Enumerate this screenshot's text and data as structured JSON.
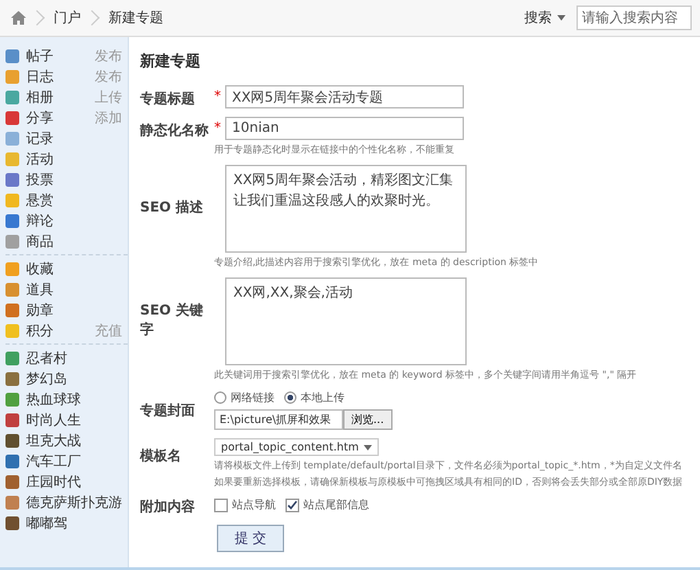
{
  "breadcrumb": {
    "items": [
      "门户",
      "新建专题"
    ],
    "search": {
      "label": "搜索",
      "placeholder": "请输入搜索内容"
    }
  },
  "sidebar": {
    "groups": [
      [
        {
          "label": "帖子",
          "action": "发布",
          "color": "#5a8fc8"
        },
        {
          "label": "日志",
          "action": "发布",
          "color": "#e8a030"
        },
        {
          "label": "相册",
          "action": "上传",
          "color": "#4aa8a0"
        },
        {
          "label": "分享",
          "action": "添加",
          "color": "#d83838"
        },
        {
          "label": "记录",
          "color": "#8ab0d8"
        },
        {
          "label": "活动",
          "color": "#e8b830"
        },
        {
          "label": "投票",
          "color": "#6a78c8"
        },
        {
          "label": "悬赏",
          "color": "#f0b820"
        },
        {
          "label": "辩论",
          "color": "#3878d0"
        },
        {
          "label": "商品",
          "color": "#a0a0a0"
        }
      ],
      [
        {
          "label": "收藏",
          "color": "#f0a020"
        },
        {
          "label": "道具",
          "color": "#d89030"
        },
        {
          "label": "勋章",
          "color": "#d07020"
        },
        {
          "label": "积分",
          "action": "充值",
          "color": "#f0c020"
        }
      ],
      [
        {
          "label": "忍者村",
          "color": "#40a060"
        },
        {
          "label": "梦幻岛",
          "color": "#8a7040"
        },
        {
          "label": "热血球球",
          "color": "#50a040"
        },
        {
          "label": "时尚人生",
          "color": "#c04040"
        },
        {
          "label": "坦克大战",
          "color": "#605030"
        },
        {
          "label": "汽车工厂",
          "color": "#3070b0"
        },
        {
          "label": "庄园时代",
          "color": "#a06030"
        },
        {
          "label": "德克萨斯扑克游",
          "color": "#c08050"
        },
        {
          "label": "嘟嘟驾",
          "color": "#705030"
        }
      ]
    ]
  },
  "form": {
    "title": "新建专题",
    "fields": [
      {
        "kind": "text",
        "label": "专题标题",
        "required": true,
        "value": "XX网5周年聚会活动专题"
      },
      {
        "kind": "text",
        "label": "静态化名称",
        "required": true,
        "value": "10nian",
        "hint": "用于专题静态化时显示在链接中的个性化名称，不能重复"
      },
      {
        "kind": "textarea",
        "label": "SEO 描述",
        "required": false,
        "value": "XX网5周年聚会活动，精彩图文汇集让我们重温这段感人的欢聚时光。",
        "hint": "专题介绍,此描述内容用于搜索引擎优化，放在 meta 的 description 标签中"
      },
      {
        "kind": "textarea",
        "label": "SEO 关键字",
        "required": false,
        "value": "XX网,XX,聚会,活动",
        "hint": "此关键词用于搜索引擎优化，放在 meta 的 keyword 标签中，多个关键字间请用半角逗号 \",\" 隔开"
      },
      {
        "kind": "upload",
        "label": "专题封面",
        "options": [
          {
            "label": "网络链接",
            "selected": false
          },
          {
            "label": "本地上传",
            "selected": true
          }
        ],
        "value": "E:\\picture\\抓屏和效果",
        "button": "浏览..."
      },
      {
        "kind": "select",
        "label": "模板名",
        "value": "portal_topic_content.htm",
        "hint": "请将模板文件上传到 template/default/portal目录下，文件名必须为portal_topic_*.htm，*为自定义文件名",
        "hint_2": "如果要重新选择模板，请确保新模板与原模板中可拖拽区域具有相同的ID，否则将会丢失部分或全部原DIY数据"
      },
      {
        "kind": "checkboxes",
        "label": "附加内容",
        "options": [
          {
            "label": "站点导航",
            "checked": false
          },
          {
            "label": "站点尾部信息",
            "checked": true
          }
        ]
      }
    ],
    "required_mark": "*",
    "submit": "提 交"
  }
}
